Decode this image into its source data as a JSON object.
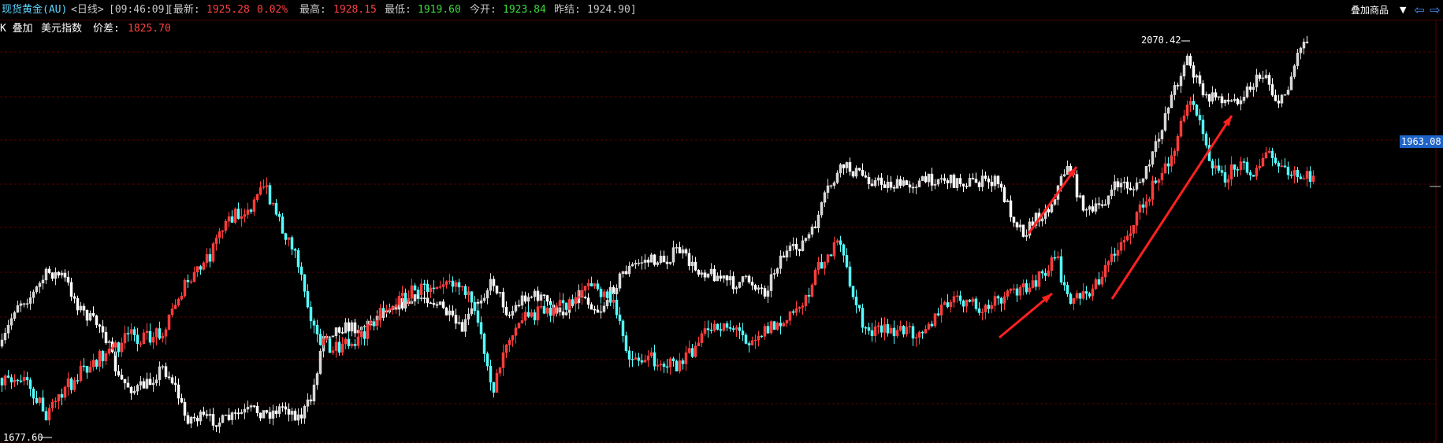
{
  "header": {
    "instrument": "现货黄金(AU)",
    "period": "<日线>",
    "time": "[09:46:09]",
    "latest_label": "[最新:",
    "latest_value": "1925.28",
    "change_pct": "0.02%",
    "high_label": "最高:",
    "high_value": "1928.15",
    "low_label": "最低:",
    "low_value": "1919.60",
    "open_label": "今开:",
    "open_value": "1923.84",
    "prev_label": "昨结:",
    "prev_value": "1924.90]",
    "overlay_button": "叠加商品"
  },
  "subheader": {
    "overlay_label": "K 叠加",
    "overlay_name": "美元指数",
    "spread_label": "价差:",
    "spread_value": "1825.70"
  },
  "chart_data": {
    "type": "candlestick",
    "price_high_label": "2070.42",
    "price_low_label": "1677.60",
    "current_price_tag": "1963.08",
    "colors": {
      "up": "#ff3d3d",
      "down": "#54ffff",
      "overlay_up": "#d8d8d8",
      "overlay_down": "#ffffff",
      "grid": "#5a0000",
      "annotation_arrow": "#ff2020"
    },
    "overlay_series_name": "美元指数",
    "grid": true
  }
}
